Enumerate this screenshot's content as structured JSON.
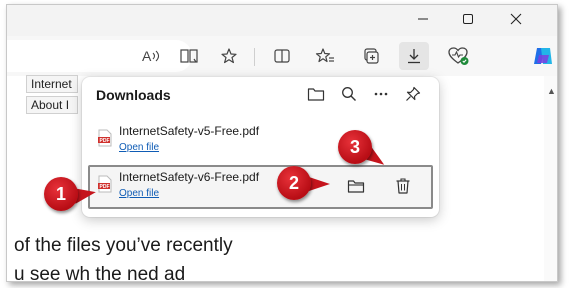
{
  "window": {
    "minimize_icon": "minimize-icon",
    "maximize_icon": "maximize-icon",
    "close_icon": "close-icon"
  },
  "toolbar": {
    "icons": [
      "read-aloud-icon",
      "immersive-reader-icon",
      "favorite-star-icon",
      "split-screen-icon",
      "favorites-icon",
      "collections-icon",
      "downloads-icon",
      "browser-essentials-icon",
      "copilot-icon"
    ]
  },
  "page": {
    "tab1": "Internet",
    "tab2": "About I",
    "text1": "of the files you’ve recently",
    "text2": "u see wh    the      ned  ad"
  },
  "downloads": {
    "title": "Downloads",
    "items": [
      {
        "filename": "InternetSafety-v5-Free.pdf",
        "action": "Open file"
      },
      {
        "filename": "InternetSafety-v6-Free.pdf",
        "action": "Open file"
      }
    ]
  },
  "callouts": [
    "1",
    "2",
    "3"
  ],
  "colors": {
    "accent_link": "#0f5cb5",
    "callout_red": "#c5141c",
    "pdf_red": "#d0312d"
  }
}
